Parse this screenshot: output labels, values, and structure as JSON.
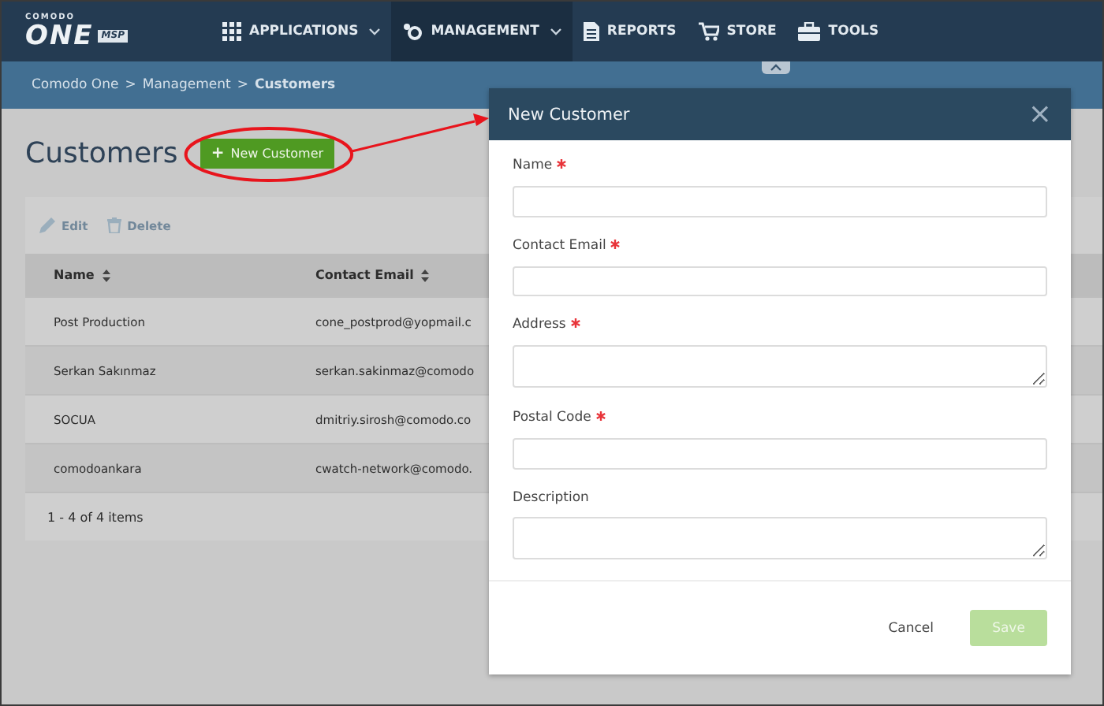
{
  "logo": {
    "brand": "COMODO",
    "name": "ONE",
    "badge": "MSP"
  },
  "nav": [
    {
      "label": "APPLICATIONS",
      "dropdown": true,
      "selected": false
    },
    {
      "label": "MANAGEMENT",
      "dropdown": true,
      "selected": true
    },
    {
      "label": "REPORTS",
      "dropdown": false,
      "selected": false
    },
    {
      "label": "STORE",
      "dropdown": false,
      "selected": false
    },
    {
      "label": "TOOLS",
      "dropdown": false,
      "selected": false
    }
  ],
  "breadcrumb": {
    "separator": ">",
    "items": [
      {
        "label": "Comodo One",
        "current": false
      },
      {
        "label": "Management",
        "current": false
      },
      {
        "label": "Customers",
        "current": true
      }
    ]
  },
  "page_title": "Customers",
  "new_button": {
    "icon": "+",
    "label": "New Customer"
  },
  "toolbar": [
    {
      "label": "Edit",
      "disabled": true
    },
    {
      "label": "Delete",
      "disabled": true
    }
  ],
  "table": {
    "columns": [
      "Name",
      "Contact Email"
    ],
    "rows": [
      [
        "Post Production",
        "cone_postprod@yopmail.c"
      ],
      [
        "Serkan Sakınmaz",
        "serkan.sakinmaz@comodo"
      ],
      [
        "SOCUA",
        "dmitriy.sirosh@comodo.co"
      ],
      [
        "comodoankara",
        "cwatch-network@comodo."
      ]
    ],
    "footer": "1 - 4 of 4 items"
  },
  "modal": {
    "title": "New Customer",
    "close": "×",
    "fields": [
      {
        "label": "Name",
        "required": true,
        "kind": "input"
      },
      {
        "label": "Contact Email",
        "required": true,
        "kind": "input"
      },
      {
        "label": "Address",
        "required": true,
        "kind": "textarea"
      },
      {
        "label": "Postal Code",
        "required": true,
        "kind": "input"
      },
      {
        "label": "Description",
        "required": false,
        "kind": "textarea"
      }
    ],
    "buttons": [
      {
        "label": "Cancel",
        "kind": "link",
        "disabled": false
      },
      {
        "label": "Save",
        "kind": "primary",
        "disabled": true
      }
    ]
  }
}
